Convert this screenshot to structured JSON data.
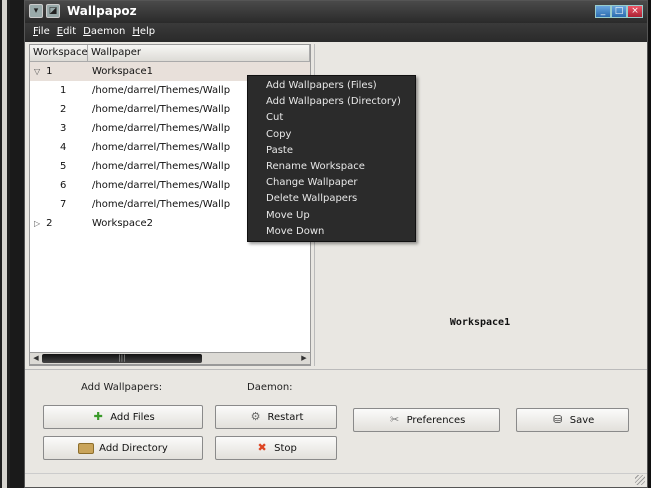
{
  "window": {
    "title": "Wallpapoz",
    "titlebar_icons": [
      "window-menu-icon",
      "app-icon"
    ],
    "controls": [
      "minimize",
      "maximize",
      "close"
    ]
  },
  "menubar": [
    {
      "label": "File",
      "mnemonic": "F",
      "rest": "ile"
    },
    {
      "label": "Edit",
      "mnemonic": "E",
      "rest": "dit"
    },
    {
      "label": "Daemon",
      "mnemonic": "D",
      "rest": "aemon"
    },
    {
      "label": "Help",
      "mnemonic": "H",
      "rest": "elp"
    }
  ],
  "tree": {
    "columns": [
      "Workspace",
      "Wallpaper"
    ],
    "rows": [
      {
        "num": "1",
        "value": "Workspace1",
        "expander": "open",
        "selected": true
      },
      {
        "num": "1",
        "value": "/home/darrel/Themes/Wallp",
        "child": true
      },
      {
        "num": "2",
        "value": "/home/darrel/Themes/Wallp",
        "child": true
      },
      {
        "num": "3",
        "value": "/home/darrel/Themes/Wallp",
        "child": true
      },
      {
        "num": "4",
        "value": "/home/darrel/Themes/Wallp",
        "child": true
      },
      {
        "num": "5",
        "value": "/home/darrel/Themes/Wallp",
        "child": true
      },
      {
        "num": "6",
        "value": "/home/darrel/Themes/Wallp",
        "child": true
      },
      {
        "num": "7",
        "value": "/home/darrel/Themes/Wallp",
        "child": true
      },
      {
        "num": "2",
        "value": "Workspace2",
        "expander": "closed"
      }
    ]
  },
  "preview": {
    "label": "Workspace1"
  },
  "context_menu": [
    "Add Wallpapers (Files)",
    "Add Wallpapers (Directory)",
    "Cut",
    "Copy",
    "Paste",
    "Rename Workspace",
    "Change Wallpaper",
    "Delete Wallpapers",
    "Move Up",
    "Move Down"
  ],
  "bottom": {
    "add_label": "Add Wallpapers:",
    "daemon_label": "Daemon:",
    "add_files": "Add Files",
    "add_directory": "Add Directory",
    "restart": "Restart",
    "stop": "Stop",
    "preferences": "Preferences",
    "save": "Save"
  }
}
